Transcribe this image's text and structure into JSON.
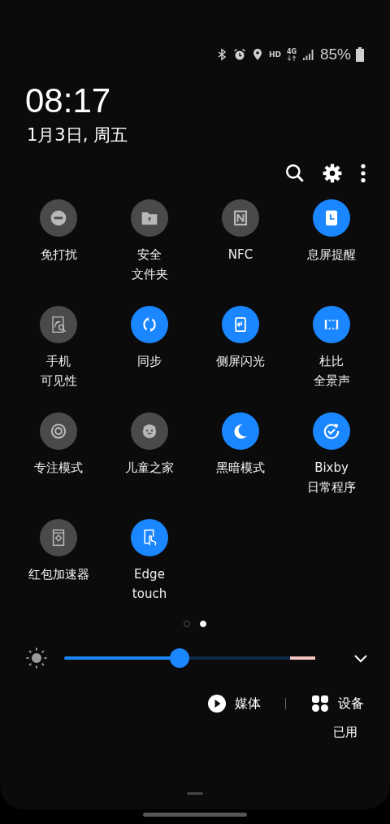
{
  "status_bar": {
    "hd": "HD",
    "network": "4G",
    "battery": "85%"
  },
  "clock": {
    "time": "08:17",
    "date": "1月3日, 周五"
  },
  "tiles": [
    {
      "kind": "dnd",
      "label": [
        "免打扰"
      ],
      "on": false
    },
    {
      "kind": "folder",
      "label": [
        "安全",
        "文件夹"
      ],
      "on": false
    },
    {
      "kind": "nfc",
      "label": [
        "NFC"
      ],
      "on": false
    },
    {
      "kind": "aod",
      "label": [
        "息屏提醒"
      ],
      "on": true
    },
    {
      "kind": "visibility",
      "label": [
        "手机",
        "可见性"
      ],
      "on": false
    },
    {
      "kind": "sync",
      "label": [
        "同步"
      ],
      "on": true
    },
    {
      "kind": "edge",
      "label": [
        "侧屏闪光"
      ],
      "on": true
    },
    {
      "kind": "dolby",
      "label": [
        "杜比",
        "全景声"
      ],
      "on": true
    },
    {
      "kind": "focus",
      "label": [
        "专注模式"
      ],
      "on": false
    },
    {
      "kind": "kids",
      "label": [
        "儿童之家"
      ],
      "on": false
    },
    {
      "kind": "moon",
      "label": [
        "黑暗模式"
      ],
      "on": true
    },
    {
      "kind": "routine",
      "label": [
        "Bixby",
        "日常程序"
      ],
      "on": true
    },
    {
      "kind": "envelope",
      "label": [
        "红包加速器"
      ],
      "on": false
    },
    {
      "kind": "touch",
      "label": [
        "Edge",
        "touch"
      ],
      "on": true
    }
  ],
  "pages": [
    {
      "selected": false
    },
    {
      "selected": true
    }
  ],
  "brightness": {
    "level": 0.46
  },
  "media": {
    "media_label": "媒体",
    "devices_label": "设备"
  },
  "usage": "已用"
}
